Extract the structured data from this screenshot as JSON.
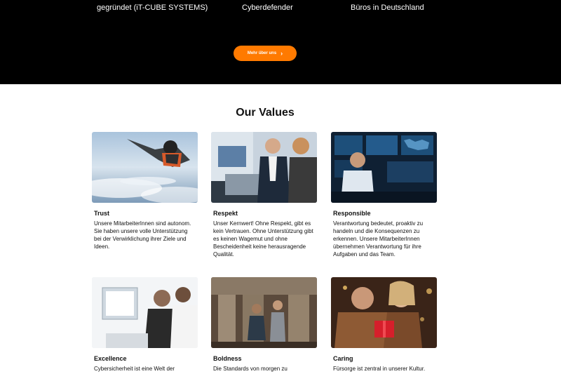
{
  "stats": {
    "item1": "gegründet (iT-CUBE SYSTEMS)",
    "item2": "Cyberdefender",
    "item3": "Büros in Deutschland"
  },
  "cta": {
    "label": "Mehr über uns",
    "icon": "chevron-right-icon"
  },
  "values": {
    "title": "Our Values",
    "cards": [
      {
        "title": "Trust",
        "text": "Unsere MitarbeiterInnen sind autonom. Sie haben unsere volle Unterstützung bei der Verwirklichung ihrer Ziele und Ideen."
      },
      {
        "title": "Respekt",
        "text": "Unser Kernwert! Ohne Respekt, gibt es kein Vertrauen. Ohne Unterstützung gibt es keinen Wagemut und ohne Bescheidenheit keine herausragende Qualität."
      },
      {
        "title": "Responsible",
        "text": "Verantwortung bedeutet, proaktiv zu handeln und die Konsequenzen zu erkennen. Unsere MitarbeiterInnen übernehmen Verantwortung für ihre Aufgaben und das Team."
      },
      {
        "title": "Excellence",
        "text": "Cybersicherheit ist eine Welt der"
      },
      {
        "title": "Boldness",
        "text": "Die Standards von morgen zu"
      },
      {
        "title": "Caring",
        "text": "Fürsorge ist zentral in unserer Kultur."
      }
    ]
  },
  "colors": {
    "hero_bg": "#000000",
    "accent": "#ff7a00",
    "text": "#111111"
  }
}
